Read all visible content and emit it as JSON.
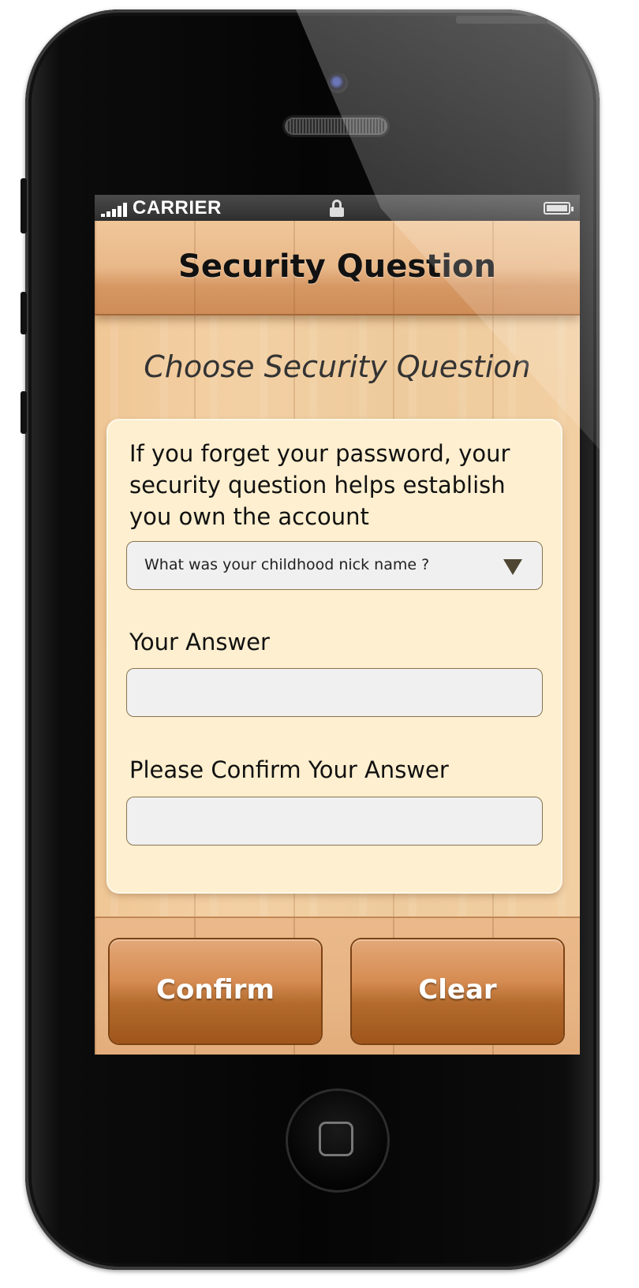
{
  "status_bar": {
    "carrier": "CARRIER"
  },
  "header": {
    "title": "Security Question"
  },
  "subtitle": "Choose Security Question",
  "card": {
    "description": "If you forget your password, your security question helps establish you own the account",
    "question_select": {
      "selected": "What was your childhood nick name ?"
    },
    "answer_label": "Your Answer",
    "answer_value": "",
    "confirm_answer_label": "Please Confirm Your Answer",
    "confirm_answer_value": ""
  },
  "buttons": {
    "confirm": "Confirm",
    "clear": "Clear"
  },
  "icons": {
    "signal": "signal-bars-icon",
    "lock": "lock-icon",
    "battery": "battery-icon",
    "dropdown": "triangle-down-icon",
    "home": "home-button-icon"
  }
}
